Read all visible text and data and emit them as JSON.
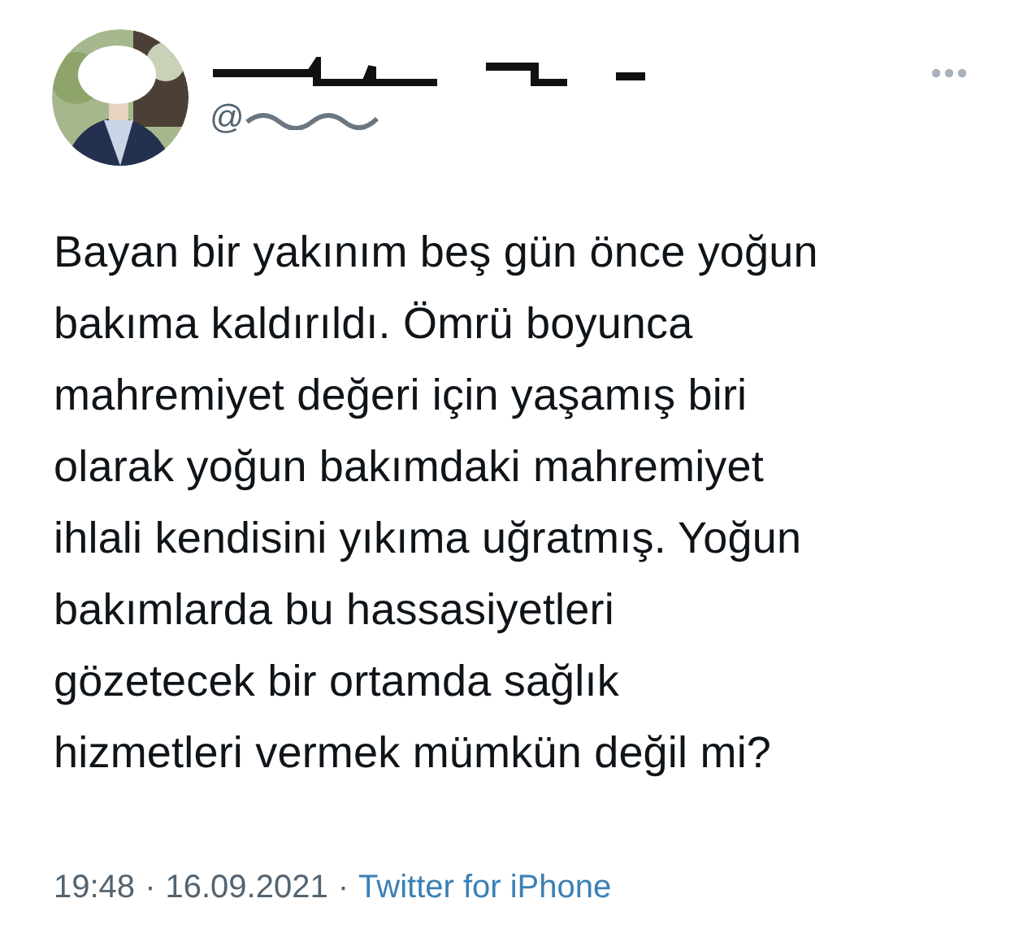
{
  "author": {
    "handle": "@"
  },
  "tweet": {
    "text": "Bayan bir yakınım beş gün önce yoğun\nbakıma kaldırıldı. Ömrü boyunca\nmahremiyet değeri için yaşamış biri\nolarak yoğun bakımdaki mahremiyet\nihlali kendisini yıkıma uğratmış. Yoğun\nbakımlarda bu hassasiyetleri\ngözetecek bir ortamda sağlık\nhizmetleri vermek mümkün değil mi?"
  },
  "meta": {
    "time": "19:48",
    "separators": [
      "·",
      "·"
    ],
    "date": "16.09.2021",
    "source": "Twitter for iPhone"
  }
}
